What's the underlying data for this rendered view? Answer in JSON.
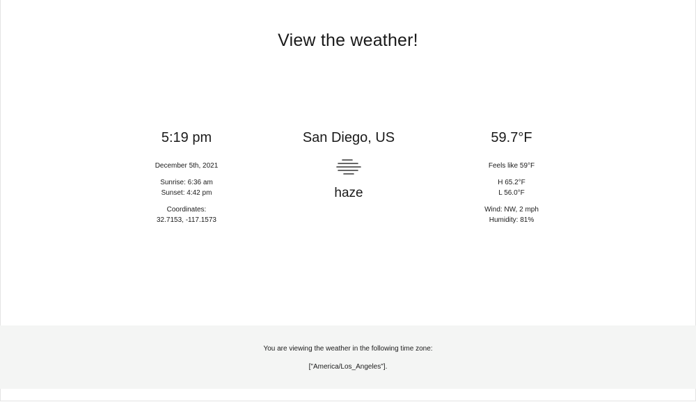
{
  "page": {
    "title": "View the weather!"
  },
  "left": {
    "time": "5:19 pm",
    "date": "December 5th, 2021",
    "sunrise": "Sunrise: 6:36 am",
    "sunset": "Sunset: 4:42 pm",
    "coordinates_label": "Coordinates:",
    "coordinates_value": "32.7153, -117.1573"
  },
  "center": {
    "location": "San Diego, US",
    "icon": "haze-icon",
    "condition": "haze"
  },
  "right": {
    "temperature": "59.7°F",
    "feels_like": "Feels like 59°F",
    "high": "H 65.2°F",
    "low": "L 56.0°F",
    "wind": "Wind: NW, 2 mph",
    "humidity": "Humidity: 81%"
  },
  "footer": {
    "line1": "You are viewing the weather in the following time zone:",
    "timezone": "[\"America/Los_Angeles\"]."
  },
  "colors": {
    "text": "#1a1a1a",
    "footer_bg": "#f4f5f4",
    "icon": "#333333"
  }
}
